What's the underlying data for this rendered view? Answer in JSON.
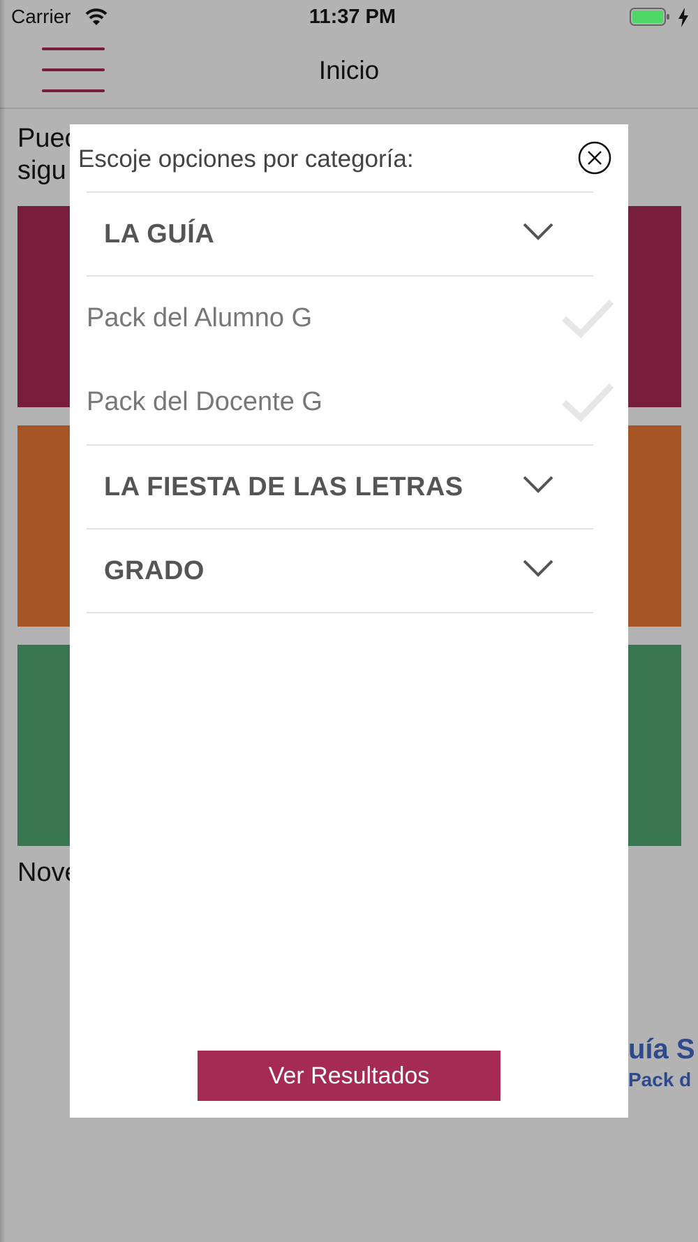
{
  "status_bar": {
    "carrier": "Carrier",
    "time": "11:37 PM",
    "battery_color": "#4cd964"
  },
  "nav": {
    "title": "Inicio",
    "menu_color": "#7a1c3c"
  },
  "background": {
    "intro_text_line1": "Puec",
    "intro_text_line2": "sigu",
    "tiles": [
      {
        "color": "#761e3c"
      },
      {
        "color": "#a55426"
      },
      {
        "color": "#387651"
      }
    ],
    "section_title": "Nove",
    "promo_title": "uía S",
    "promo_subtitle": "Pack d"
  },
  "modal": {
    "header": "Escoje opciones por categoría:",
    "close_icon": "circle-x-icon",
    "categories": [
      {
        "label": "LA GUÍA",
        "expanded": true,
        "items": [
          {
            "label": "Pack del Alumno G",
            "checked": false
          },
          {
            "label": "Pack del Docente G",
            "checked": false
          }
        ]
      },
      {
        "label": "LA FIESTA DE LAS LETRAS",
        "expanded": false
      },
      {
        "label": "GRADO",
        "expanded": false
      }
    ],
    "submit_label": "Ver Resultados",
    "submit_color": "#a52b55"
  }
}
